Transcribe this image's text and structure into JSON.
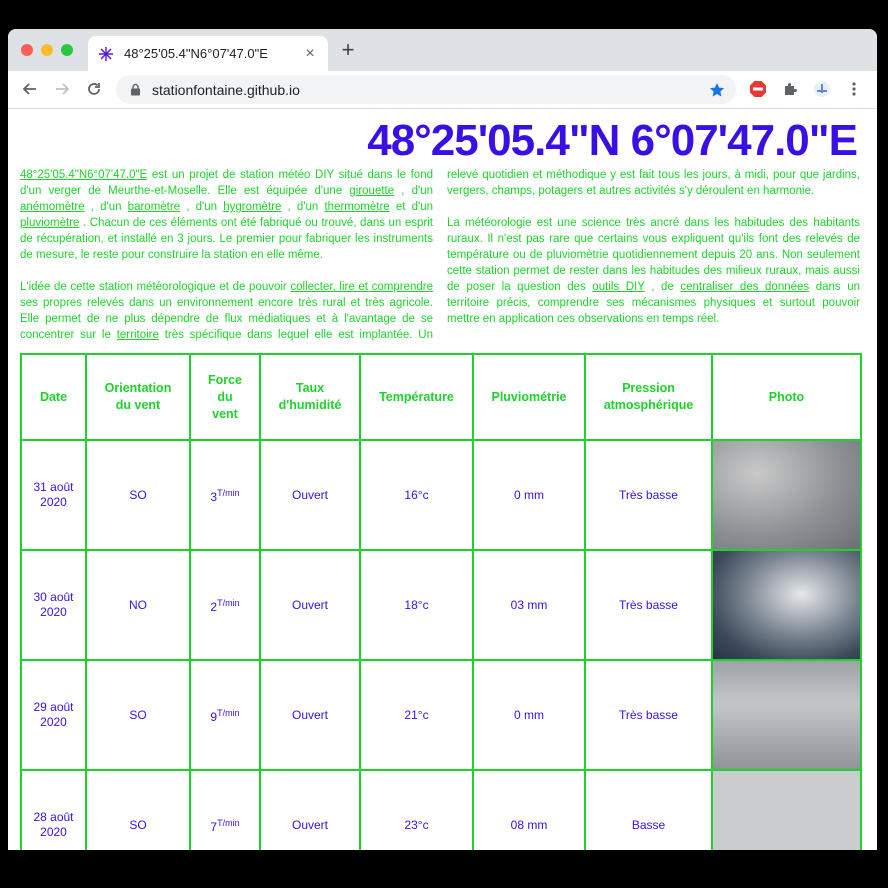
{
  "browser": {
    "tab_title": "48°25'05.4\"N6°07'47.0\"E",
    "url": "stationfontaine.github.io",
    "new_tab_label": "+",
    "close_label": "×"
  },
  "page": {
    "title": "48°25'05.4\"N 6°07'47.0\"E",
    "intro": {
      "p1": {
        "link_coords": "48°25'05.4\"N6°07'47.0\"E",
        "t1": " est un projet de station météo DIY situé dans le fond d'un verger de Meurthe-et-Moselle. Elle est équipée d'une ",
        "l_girouette": "girouette",
        "t2": " , d'un ",
        "l_anemometre": "anémomètre",
        "t3": " , d'un ",
        "l_barometre": "baromètre",
        "t4": " , d'un ",
        "l_hygrometre": "hygromètre",
        "t5": " , d'un ",
        "l_thermometre": "thermomètre",
        "t6": " et d'un ",
        "l_pluviometre": "pluviomètre",
        "t7": " . Chacun de ces éléments ont été fabriqué ou trouvé, dans un esprit de récupération, et installé en 3 jours. Le premier pour fabriquer les instruments de mesure, le reste pour construire la station en elle même."
      },
      "p2": {
        "t1": "L'idée de cette station météorologique et de pouvoir ",
        "l_collecter": "collecter, lire et comprendre",
        "t2": " ses propres relevés dans un environnement encore très rural et très agricole. Elle permet de ne plus dépendre de flux médiatiques et à l'avantage de se concentrer sur le ",
        "l_territoire": "territoire",
        "t3": " très spécifique dans lequel elle est implantée. Un relevé quotidien et méthodique y est fait tous les jours, à midi, pour que jardins, vergers, champs, potagers et autres activités s'y déroulent en harmonie."
      },
      "p3": {
        "t1": "La météorologie est une science très ancré dans les habitudes des habitants ruraux. Il n'est pas rare que certains vous expliquent qu'ils font des relevés de température ou de pluviomètrie quotidiennement depuis 20 ans. Non seulement cette station permet de rester dans les habitudes des milieux ruraux, mais aussi de poser la question des ",
        "l_outils": "outils DIY",
        "t2": " , de ",
        "l_centraliser": "centraliser des données",
        "t3": " dans un territoire précis, comprendre ses mécanismes physiques et surtout pouvoir mettre en application ces observations en temps réel."
      }
    },
    "table": {
      "headers": {
        "date": "Date",
        "orientation": "Orientation du vent",
        "force": "Force du vent",
        "humidite": "Taux d'humidité",
        "temperature": "Température",
        "pluviometrie": "Pluviométrie",
        "pression": "Pression atmosphérique",
        "photo": "Photo"
      },
      "rows": [
        {
          "date": "31 août 2020",
          "orientation": "SO",
          "force": "3",
          "force_unit": "T/min",
          "humidite": "Ouvert",
          "temperature": "16°c",
          "pluviometrie": "0 mm",
          "pression": "Très basse"
        },
        {
          "date": "30 août 2020",
          "orientation": "NO",
          "force": "2",
          "force_unit": "T/min",
          "humidite": "Ouvert",
          "temperature": "18°c",
          "pluviometrie": "03 mm",
          "pression": "Très basse"
        },
        {
          "date": "29 août 2020",
          "orientation": "SO",
          "force": "9",
          "force_unit": "T/min",
          "humidite": "Ouvert",
          "temperature": "21°c",
          "pluviometrie": "0 mm",
          "pression": "Très basse"
        },
        {
          "date": "28 août 2020",
          "orientation": "SO",
          "force": "7",
          "force_unit": "T/min",
          "humidite": "Ouvert",
          "temperature": "23°c",
          "pluviometrie": "08 mm",
          "pression": "Basse"
        }
      ]
    }
  },
  "colors": {
    "title_blue": "#3a0fe6",
    "accent_green": "#1fd22b"
  }
}
